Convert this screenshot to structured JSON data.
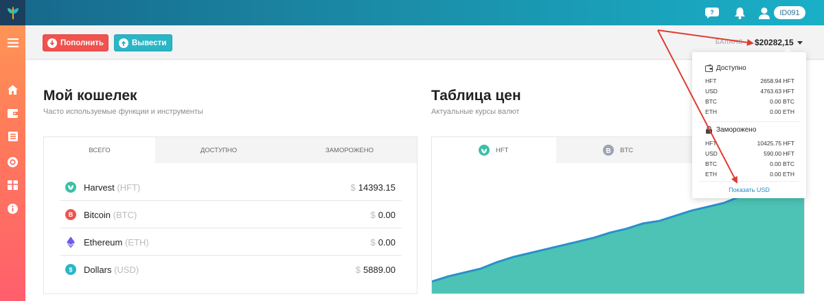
{
  "header": {
    "user_id": "ID091"
  },
  "actions": {
    "deposit_label": "Пополнить",
    "withdraw_label": "Вывести"
  },
  "balance": {
    "label": "БАЛАНС",
    "value": "$20282,15"
  },
  "wallet": {
    "title": "Мой кошелек",
    "subtitle": "Часто используемые функции и инструменты",
    "tabs": [
      "ВСЕГО",
      "ДОСТУПНО",
      "ЗАМОРОЖЕНО"
    ],
    "currency_symbol": "$",
    "rows": [
      {
        "name": "Harvest",
        "code": "(HFT)",
        "amount": "14393.15",
        "icon": "harvest-icon",
        "color": "#3bbfa7"
      },
      {
        "name": "Bitcoin",
        "code": "(BTC)",
        "amount": "0.00",
        "icon": "bitcoin-icon",
        "color": "#f0524e"
      },
      {
        "name": "Ethereum",
        "code": "(ETH)",
        "amount": "0.00",
        "icon": "ethereum-icon",
        "color": "#6c5ce7"
      },
      {
        "name": "Dollars",
        "code": "(USD)",
        "amount": "5889.00",
        "icon": "dollar-icon",
        "color": "#29b6c7"
      }
    ]
  },
  "prices": {
    "title": "Таблица цен",
    "subtitle": "Актуальные курсы валют",
    "tabs": [
      "HFT",
      "BTC"
    ]
  },
  "chart_data": {
    "type": "area",
    "series": [
      {
        "values": [
          0.05,
          0.09,
          0.12,
          0.15,
          0.2,
          0.24,
          0.27,
          0.3,
          0.33,
          0.36,
          0.39,
          0.43,
          0.46,
          0.5,
          0.52,
          0.56,
          0.6,
          0.63,
          0.66,
          0.71,
          0.76,
          0.8,
          0.84,
          0.88
        ]
      }
    ],
    "fill_color": "#4cc3b5",
    "line_color": "#2a8fc9"
  },
  "dropdown": {
    "available": {
      "title": "Доступно",
      "rows": [
        {
          "k": "HFT",
          "v": "2658.94 HFT"
        },
        {
          "k": "USD",
          "v": "4763.63 HFT"
        },
        {
          "k": "BTC",
          "v": "0.00 BTC"
        },
        {
          "k": "ETH",
          "v": "0.00 ETH"
        }
      ]
    },
    "frozen": {
      "title": "Заморожено",
      "rows": [
        {
          "k": "HFT",
          "v": "10425.75 HFT"
        },
        {
          "k": "USD",
          "v": "590.00 HFT"
        },
        {
          "k": "BTC",
          "v": "0.00 BTC"
        },
        {
          "k": "ETH",
          "v": "0.00 ETH"
        }
      ]
    },
    "link": "Показать USD"
  },
  "colors": {
    "sidebar_top": "#ff9a55",
    "sidebar_bottom": "#ff5f6d",
    "topbar": "#1b8ca8",
    "annotation_arrow": "#e03a2f"
  }
}
